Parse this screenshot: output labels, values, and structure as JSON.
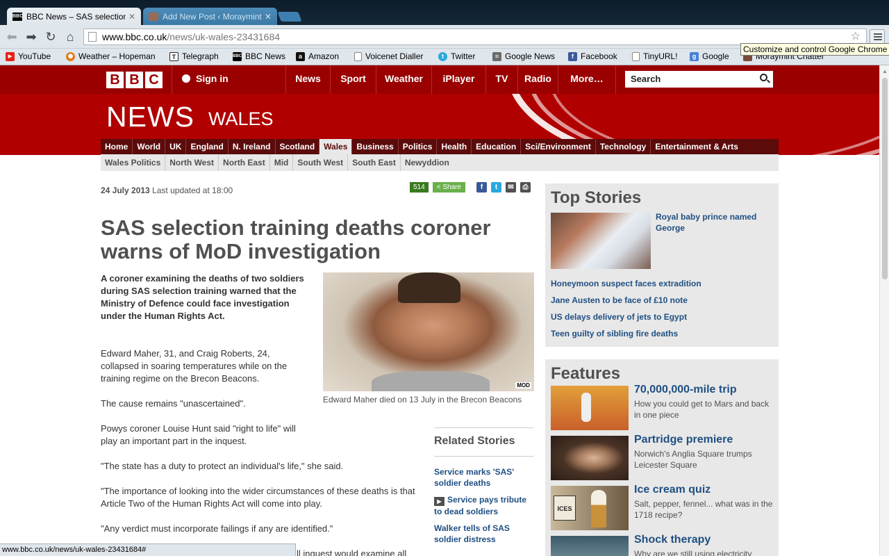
{
  "tabs": [
    {
      "title": "BBC News – SAS selection t",
      "favicon": "BBC",
      "active": true
    },
    {
      "title": "Add New Post ‹ Moraymint",
      "favicon": "",
      "active": false
    }
  ],
  "toolbar": {
    "url_host": "www.bbc.co.uk",
    "url_path": "/news/uk-wales-23431684",
    "tooltip": "Customize and control Google Chrome"
  },
  "bookmarks": [
    {
      "label": "YouTube",
      "icon": "youtube-icon",
      "color": "#e62117",
      "glyph": "▶"
    },
    {
      "label": "Weather – Hopeman",
      "icon": "weather-icon",
      "color": "#e07b1a",
      "glyph": "✺"
    },
    {
      "label": "Telegraph",
      "icon": "telegraph-icon",
      "color": "#222222",
      "glyph": "T"
    },
    {
      "label": "BBC News",
      "icon": "bbc-icon",
      "color": "#000000",
      "glyph": "BBC"
    },
    {
      "label": "Amazon",
      "icon": "amazon-icon",
      "color": "#111111",
      "glyph": "a"
    },
    {
      "label": "Voicenet Dialler",
      "icon": "page-icon",
      "color": "#ffffff",
      "glyph": ""
    },
    {
      "label": "Twitter",
      "icon": "twitter-icon",
      "color": "#2aa9e0",
      "glyph": "t"
    },
    {
      "label": "Google News",
      "icon": "news-icon",
      "color": "#6b6b6b",
      "glyph": "≡"
    },
    {
      "label": "Facebook",
      "icon": "facebook-icon",
      "color": "#3b5998",
      "glyph": "f"
    },
    {
      "label": "TinyURL!",
      "icon": "page-icon",
      "color": "#ffffff",
      "glyph": ""
    },
    {
      "label": "Google",
      "icon": "google-icon",
      "color": "#4a7fd8",
      "glyph": "g"
    },
    {
      "label": "Moraymint Chatter",
      "icon": "moraymint-icon",
      "color": "#7a4a3a",
      "glyph": ""
    }
  ],
  "bbc": {
    "logo": [
      "B",
      "B",
      "C"
    ],
    "signin": "Sign in",
    "global_nav": [
      "News",
      "Sport",
      "Weather",
      "iPlayer",
      "TV",
      "Radio",
      "More…"
    ],
    "search_placeholder": "Search",
    "title": "NEWS",
    "subtitle": "WALES",
    "local_nav": [
      "Home",
      "World",
      "UK",
      "England",
      "N. Ireland",
      "Scotland",
      "Wales",
      "Business",
      "Politics",
      "Health",
      "Education",
      "Sci/Environment",
      "Technology",
      "Entertainment & Arts"
    ],
    "local_nav_selected": "Wales",
    "sub_nav": [
      "Wales Politics",
      "North West",
      "North East",
      "Mid",
      "South West",
      "South East",
      "Newyddion"
    ]
  },
  "article": {
    "date": "24 July 2013",
    "updated": "Last updated at 18:00",
    "share_count": "514",
    "share_label": "Share",
    "headline": "SAS selection training deaths coroner warns of MoD investigation",
    "intro": "A coroner examining the deaths of two soldiers during SAS selection training warned that the Ministry of Defence could face investigation under the Human Rights Act.",
    "paragraphs": [
      "Edward Maher, 31, and Craig Roberts, 24, collapsed in soaring temperatures while on the training regime on the Brecon Beacons.",
      "The cause remains \"unascertained\".",
      "Powys coroner Louise Hunt said \"right to life\" will play an important part in the inquest.",
      "\"The state has a duty to protect an individual's life,\" she said.",
      "\"The importance of looking into the wider circumstances of these deaths is that Article Two of the Human Rights Act will come into play.",
      "\"Any verdict must incorporate failings if any are identified.\"",
      "ll inquest would examine all"
    ],
    "photo_credit": "MOD",
    "caption": "Edward Maher died on 13 July in the Brecon Beacons",
    "related_title": "Related Stories",
    "related": [
      {
        "label": "Service marks 'SAS' soldier deaths",
        "video": false
      },
      {
        "label": "Service pays tribute to dead soldiers",
        "video": true
      },
      {
        "label": "Walker tells of SAS soldier distress",
        "video": false
      }
    ]
  },
  "top_stories": {
    "title": "Top Stories",
    "lead": "Royal baby prince named George",
    "items": [
      "Honeymoon suspect faces extradition",
      "Jane Austen to be face of £10 note",
      "US delays delivery of jets to Egypt",
      "Teen guilty of sibling fire deaths"
    ]
  },
  "features": {
    "title": "Features",
    "items": [
      {
        "title": "70,000,000-mile trip",
        "desc": "How you could get to Mars and back in one piece"
      },
      {
        "title": "Partridge premiere",
        "desc": "Norwich's Anglia Square trumps Leicester Square"
      },
      {
        "title": "Ice cream quiz",
        "desc": "Salt, pepper, fennel... what was in the 1718 recipe?"
      },
      {
        "title": "Shock therapy",
        "desc": "Why are we still using electricity"
      }
    ],
    "ice_sign": "ICES"
  },
  "status_url": "www.bbc.co.uk/news/uk-wales-23431684#",
  "colors": {
    "bbc_red": "#9a0000",
    "masthead": "#b00000",
    "link": "#1f4f82"
  }
}
